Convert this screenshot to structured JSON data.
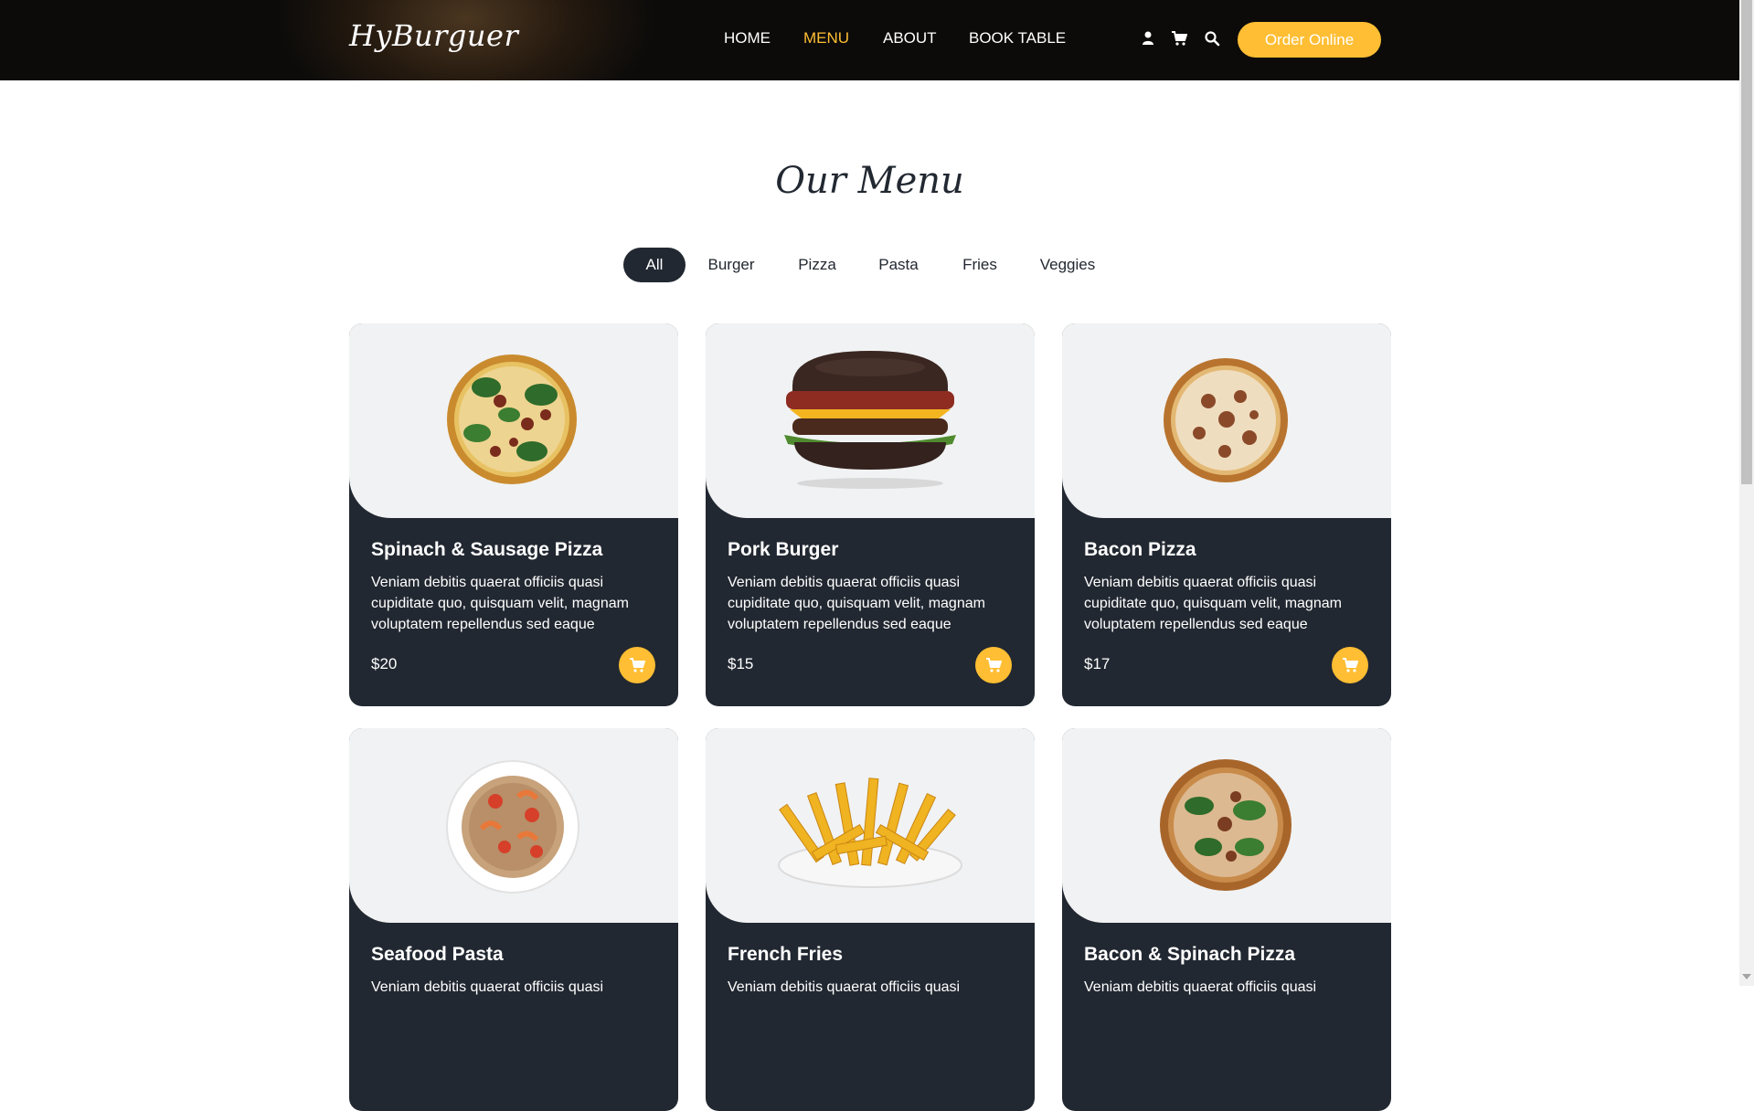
{
  "header": {
    "logo": "HyBurguer",
    "nav": [
      {
        "label": "HOME",
        "active": false
      },
      {
        "label": "MENU",
        "active": true
      },
      {
        "label": "ABOUT",
        "active": false
      },
      {
        "label": "BOOK TABLE",
        "active": false
      }
    ],
    "icons": [
      "user-icon",
      "cart-icon",
      "search-icon"
    ],
    "order_button": "Order Online"
  },
  "menu": {
    "title": "Our Menu",
    "filters": [
      {
        "label": "All",
        "active": true
      },
      {
        "label": "Burger",
        "active": false
      },
      {
        "label": "Pizza",
        "active": false
      },
      {
        "label": "Pasta",
        "active": false
      },
      {
        "label": "Fries",
        "active": false
      },
      {
        "label": "Veggies",
        "active": false
      }
    ],
    "items": [
      {
        "title": "Spinach & Sausage Pizza",
        "description": "Veniam debitis quaerat officiis quasi cupiditate quo, quisquam velit, magnam voluptatem repellendus sed eaque",
        "price": "$20",
        "image": "pizza"
      },
      {
        "title": "Pork Burger",
        "description": "Veniam debitis quaerat officiis quasi cupiditate quo, quisquam velit, magnam voluptatem repellendus sed eaque",
        "price": "$15",
        "image": "burger"
      },
      {
        "title": "Bacon Pizza",
        "description": "Veniam debitis quaerat officiis quasi cupiditate quo, quisquam velit, magnam voluptatem repellendus sed eaque",
        "price": "$17",
        "image": "pizza"
      },
      {
        "title": "Seafood Pasta",
        "description": "Veniam debitis quaerat officiis quasi",
        "image": "pasta"
      },
      {
        "title": "French Fries",
        "description": "Veniam debitis quaerat officiis quasi",
        "image": "fries"
      },
      {
        "title": "Bacon & Spinach Pizza",
        "description": "Veniam debitis quaerat officiis quasi",
        "image": "pizza"
      }
    ]
  },
  "colors": {
    "accent": "#ffbe33",
    "dark": "#222831",
    "header_bg": "#0c0b0a",
    "card_image_bg": "#f1f2f3"
  }
}
